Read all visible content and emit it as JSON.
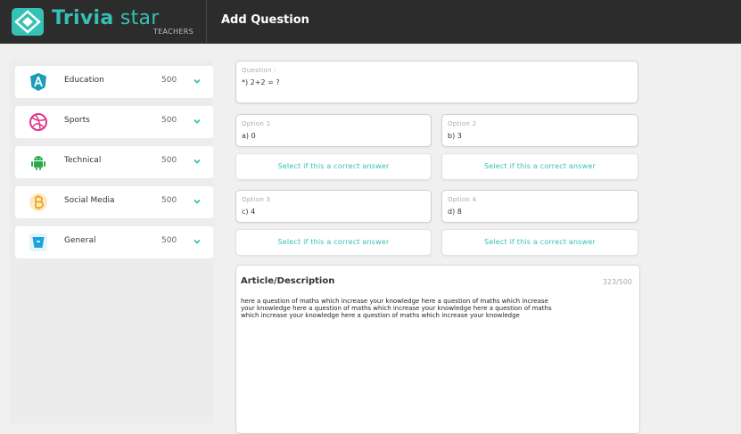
{
  "header": {
    "logo_bold": "Trivia",
    "logo_light": "star",
    "logo_sub": "TEACHERS",
    "page_title": "Add Question",
    "accent_color": "#35c1b4"
  },
  "sidebar": {
    "categories": [
      {
        "label": "Education",
        "count": "500",
        "icon": "education-icon",
        "color": "#1a9db8"
      },
      {
        "label": "Sports",
        "count": "500",
        "icon": "dribbble-icon",
        "color": "#e0338a"
      },
      {
        "label": "Technical",
        "count": "500",
        "icon": "android-icon",
        "color": "#2aa84a"
      },
      {
        "label": "Social Media",
        "count": "500",
        "icon": "bitcoin-icon",
        "color": "#f2a61b"
      },
      {
        "label": "General",
        "count": "500",
        "icon": "bucket-icon",
        "color": "#1aa3e0"
      }
    ]
  },
  "question": {
    "label": "Question :",
    "value": "*) 2+2 = ?"
  },
  "options": [
    {
      "label": "Option 1",
      "value": "a) 0",
      "select_label": "Select if this a correct answer"
    },
    {
      "label": "Option 2",
      "value": "b) 3",
      "select_label": "Select if this a correct answer"
    },
    {
      "label": "Option 3",
      "value": "c) 4",
      "select_label": "Select if this a correct answer"
    },
    {
      "label": "Option 4",
      "value": "d) 8",
      "select_label": "Select if this a correct answer"
    }
  ],
  "article": {
    "title": "Article/Description",
    "count": "323/500",
    "lines": [
      "here a question of maths which increase your knowledge here a question of maths which increase",
      "your knowledge here a question of maths which increase your knowledge here a question of maths",
      "which increase your knowledge here a question of maths which increase your knowledge"
    ]
  }
}
